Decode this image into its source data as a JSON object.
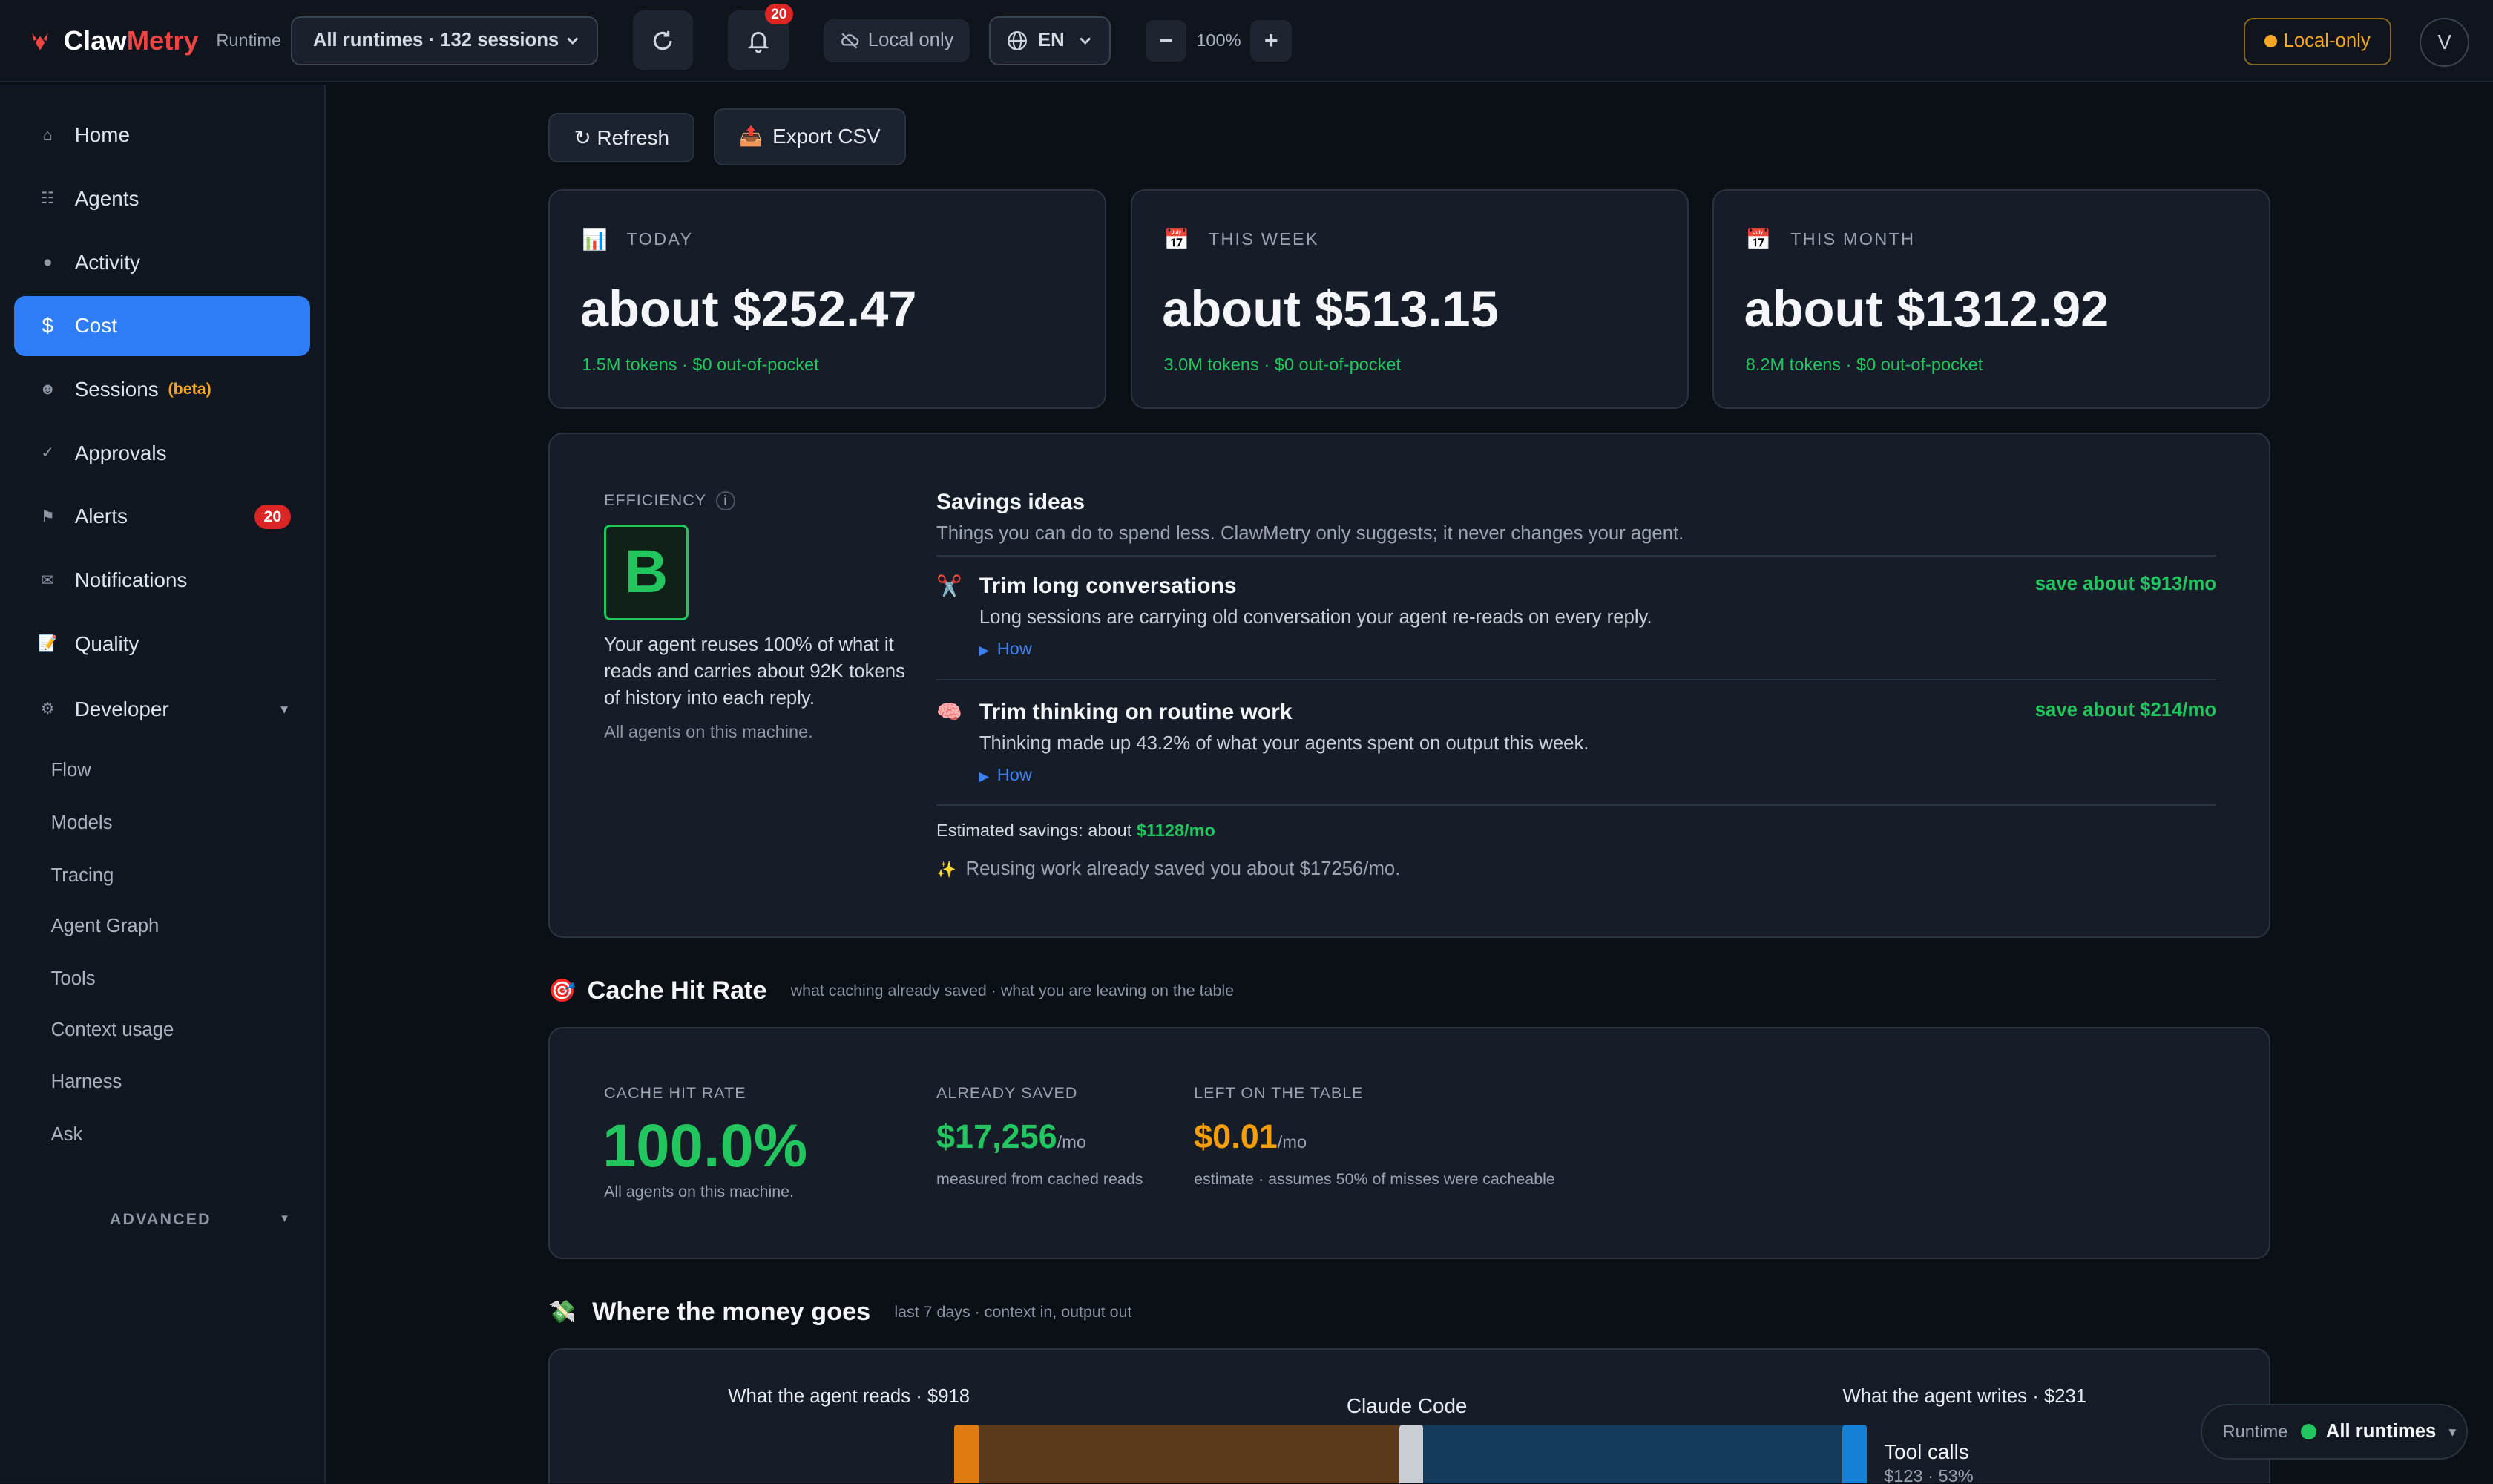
{
  "header": {
    "brand_prefix": "Claw",
    "brand_suffix": "Metry",
    "runtime_label": "Runtime",
    "runtime_value": "All runtimes · 132 sessions",
    "bell_count": "20",
    "local_only_pill": "Local only",
    "language": "EN",
    "zoom_minus": "−",
    "zoom_value": "100%",
    "zoom_plus": "+",
    "local_only_badge": "Local-only",
    "avatar_initial": "V"
  },
  "sidebar": {
    "items": [
      {
        "icon": "⌂",
        "label": "Home"
      },
      {
        "icon": "☷",
        "label": "Agents"
      },
      {
        "icon": "●",
        "label": "Activity"
      },
      {
        "icon": "$",
        "label": "Cost"
      },
      {
        "icon": "☻",
        "label": "Sessions",
        "tag": "(beta)"
      },
      {
        "icon": "✓",
        "label": "Approvals"
      },
      {
        "icon": "⚑",
        "label": "Alerts",
        "badge": "20"
      },
      {
        "icon": "✉",
        "label": "Notifications"
      },
      {
        "icon": "📝",
        "label": "Quality"
      },
      {
        "icon": "⚙",
        "label": "Developer",
        "caret": "▾"
      }
    ],
    "sub_items": [
      "Flow",
      "Models",
      "Tracing",
      "Agent Graph",
      "Tools",
      "Context usage",
      "Harness",
      "Ask"
    ],
    "advanced_label": "ADVANCED",
    "advanced_caret": "▾"
  },
  "toolbar": {
    "refresh_label": "↻ Refresh",
    "export_icon": "📤",
    "export_label": "Export CSV"
  },
  "periods": [
    {
      "icon": "📊",
      "label": "TODAY",
      "amount": "about $252.47",
      "tokens": "1.5M tokens · $0 out-of-pocket"
    },
    {
      "icon": "📅",
      "label": "THIS WEEK",
      "amount": "about $513.15",
      "tokens": "3.0M tokens · $0 out-of-pocket"
    },
    {
      "icon": "📅",
      "label": "THIS MONTH",
      "amount": "about $1312.92",
      "tokens": "8.2M tokens · $0 out-of-pocket"
    }
  ],
  "efficiency": {
    "label": "EFFICIENCY",
    "info": "i",
    "grade": "B",
    "description": "Your agent reuses 100% of what it reads and carries about 92K tokens of history into each reply.",
    "scope": "All agents on this machine."
  },
  "savings": {
    "title": "Savings ideas",
    "subtitle": "Things you can do to spend less. ClawMetry only suggests; it never changes your agent.",
    "ideas": [
      {
        "icon": "✂️",
        "title": "Trim long conversations",
        "text": "Long sessions are carrying old conversation your agent re-reads on every reply.",
        "how": "How",
        "save": "save about $913/mo"
      },
      {
        "icon": "🧠",
        "title": "Trim thinking on routine work",
        "text": "Thinking made up 43.2% of what your agents spent on output this week.",
        "how": "How",
        "save": "save about $214/mo"
      }
    ],
    "estimated_label": "Estimated savings: about",
    "estimated_value": "$1128/mo",
    "reuse_icon": "✨",
    "reuse_note": "Reusing work already saved you about $17256/mo."
  },
  "cache": {
    "icon": "🎯",
    "title": "Cache Hit Rate",
    "subtitle": "what caching already saved · what you are leaving on the table",
    "hit_label": "CACHE HIT RATE",
    "hit_value": "100.0%",
    "hit_scope": "All agents on this machine.",
    "saved_label": "ALREADY SAVED",
    "saved_value": "$17,256",
    "saved_unit": "/mo",
    "saved_note": "measured from cached reads",
    "left_label": "LEFT ON THE TABLE",
    "left_value": "$0.01",
    "left_unit": "/mo",
    "left_note": "estimate · assumes 50% of misses were cacheable"
  },
  "money": {
    "icon": "💸",
    "title": "Where the money goes",
    "subtitle": "last 7 days · context in, output out",
    "reads_label": "What the agent reads · $918",
    "center_label": "Claude Code",
    "writes_label": "What the agent writes · $231",
    "tool_label": "Tool calls",
    "tool_value": "$123 · 53%"
  },
  "runtime_chip": {
    "label": "Runtime",
    "value": "All runtimes",
    "caret": "▾"
  },
  "colors": {
    "accent": "#2f7df6",
    "positive": "#22c55e",
    "warning": "#f59e0b",
    "danger": "#dc2626",
    "reads_flow": "#5a3a1a",
    "writes_flow": "#143a5c"
  }
}
